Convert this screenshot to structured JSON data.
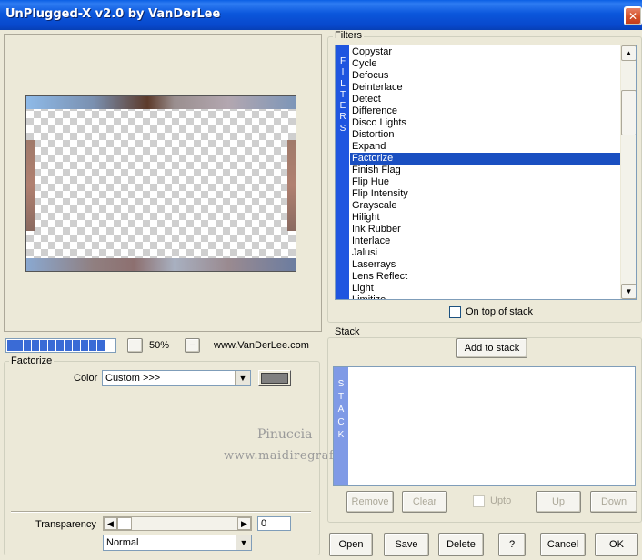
{
  "window": {
    "title": "UnPlugged-X v2.0 by VanDerLee",
    "close_glyph": "✕"
  },
  "preview": {
    "zoom_in_label": "+",
    "zoom_value": "50%",
    "zoom_out_label": "−",
    "website": "www.VanDerLee.com",
    "progress_segments": 12
  },
  "factorize": {
    "group_label": "Factorize",
    "color_label": "Color",
    "color_value": "Custom >>>",
    "swatch_color": "#808080",
    "transparency_label": "Transparency",
    "transparency_value": "0",
    "blend_value": "Normal"
  },
  "watermark": {
    "line1": "Pinuccia",
    "line2": "www.maidiregrafica.eu"
  },
  "filters": {
    "group_label": "Filters",
    "vertical_label": "FILTERS",
    "items": [
      "Copystar",
      "Cycle",
      "Defocus",
      "Deinterlace",
      "Detect",
      "Difference",
      "Disco Lights",
      "Distortion",
      "Expand",
      "Factorize",
      "Finish Flag",
      "Flip Hue",
      "Flip Intensity",
      "Grayscale",
      "Hilight",
      "Ink Rubber",
      "Interlace",
      "Jalusi",
      "Laserrays",
      "Lens Reflect",
      "Light",
      "Limitize"
    ],
    "selected_index": 9,
    "on_top_label": "On top of stack"
  },
  "stack": {
    "group_label": "Stack",
    "vertical_label": "STACK",
    "add_label": "Add to stack",
    "remove_label": "Remove",
    "clear_label": "Clear",
    "upto_label": "Upto",
    "up_label": "Up",
    "down_label": "Down"
  },
  "footer": {
    "open_label": "Open",
    "save_label": "Save",
    "delete_label": "Delete",
    "help_label": "?",
    "cancel_label": "Cancel",
    "ok_label": "OK"
  }
}
